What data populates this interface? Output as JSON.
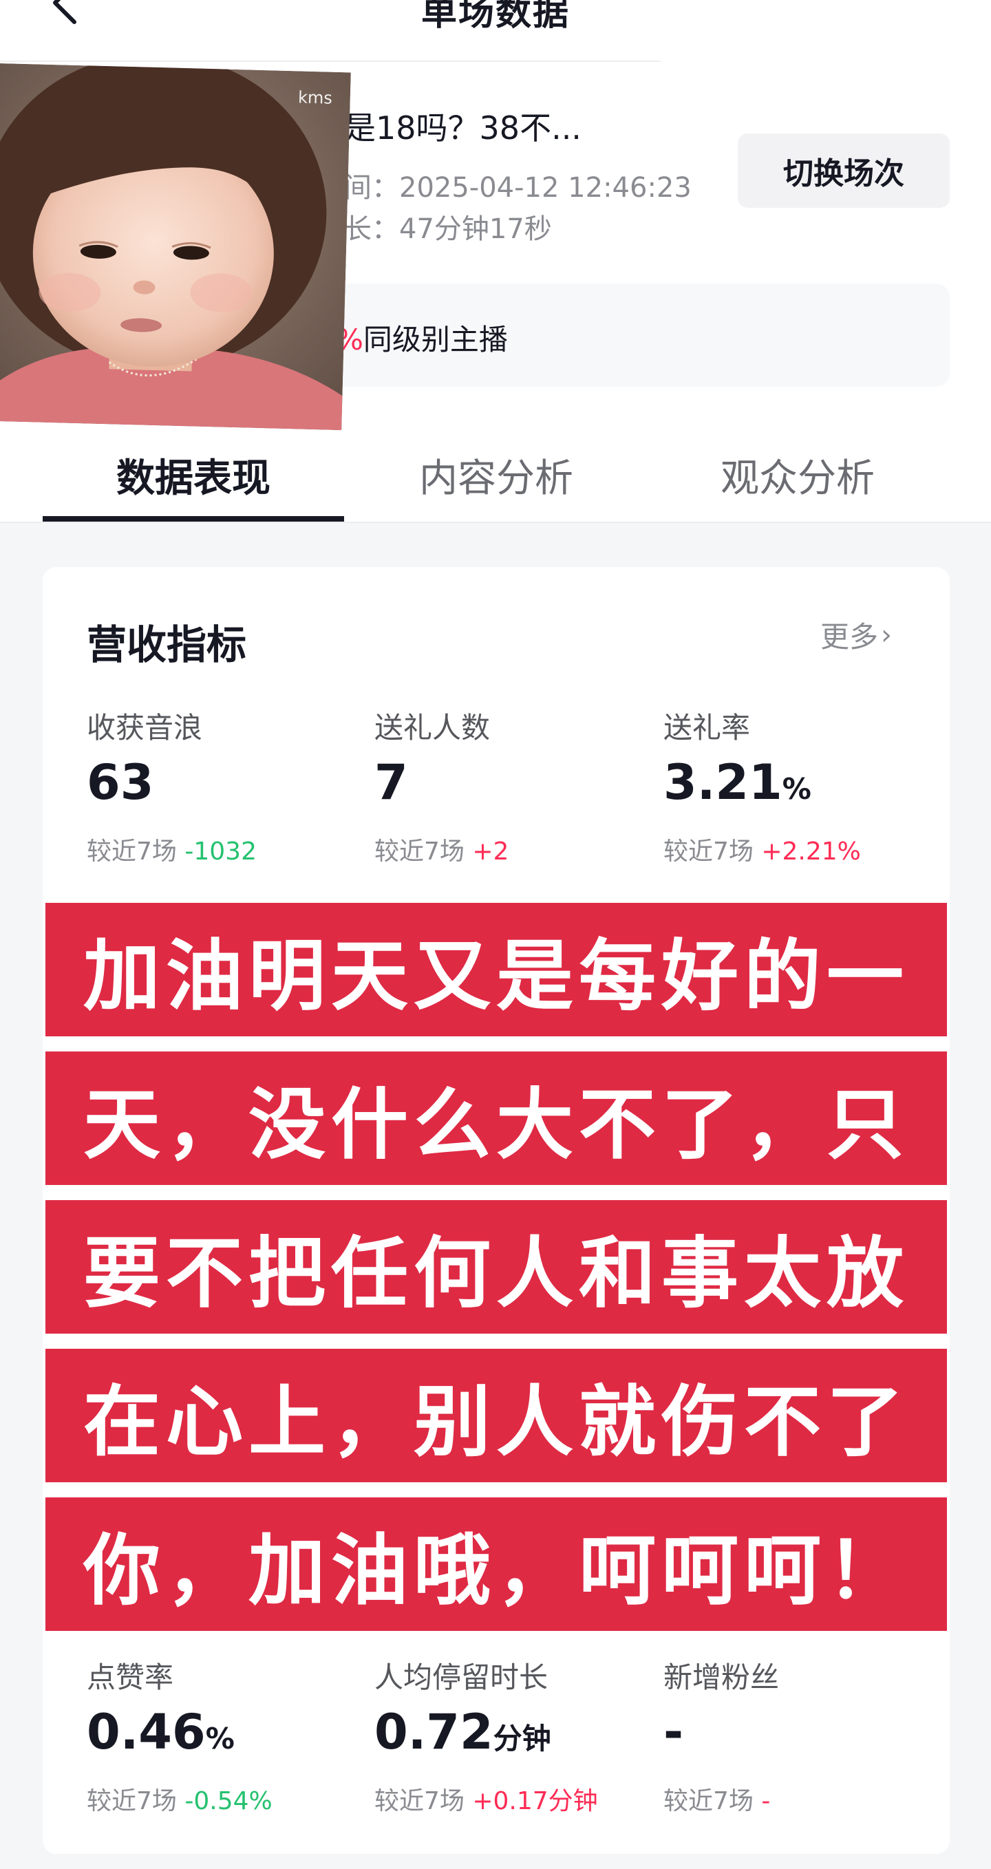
{
  "nav": {
    "title": "单场数据",
    "back_icon": "chevron-left-icon"
  },
  "sticker": {
    "watermark": "kms"
  },
  "session": {
    "title": "是18吗？38不...",
    "start_time": "间：2025-04-12 12:46:23",
    "duration": "长：47分钟17秒",
    "switch_label": "切换场次"
  },
  "compare": {
    "percent_fragment": "%",
    "text": "同级别主播"
  },
  "tabs": [
    {
      "label": "数据表现",
      "active": true
    },
    {
      "label": "内容分析",
      "active": false
    },
    {
      "label": "观众分析",
      "active": false
    }
  ],
  "revenue": {
    "title": "营收指标",
    "more_label": "更多",
    "metrics": [
      {
        "label": "收获音浪",
        "value": "63",
        "unit": "",
        "compare_prefix": "较近7场",
        "delta": "-1032",
        "delta_color": "#25c16f"
      },
      {
        "label": "送礼人数",
        "value": "7",
        "unit": "",
        "compare_prefix": "较近7场",
        "delta": "+2",
        "delta_color": "#fe2c55"
      },
      {
        "label": "送礼率",
        "value": "3.21",
        "unit": "%",
        "compare_prefix": "较近7场",
        "delta": "+2.21%",
        "delta_color": "#fe2c55"
      },
      {
        "label": "点赞率",
        "value": "0.46",
        "unit": "%",
        "compare_prefix": "较近7场",
        "delta": "-0.54%",
        "delta_color": "#25c16f"
      },
      {
        "label": "人均停留时长",
        "value": "0.72",
        "unit": "分钟",
        "compare_prefix": "较近7场",
        "delta": "+0.17分钟",
        "delta_color": "#fe2c55"
      },
      {
        "label": "新增粉丝",
        "value": "-",
        "unit": "",
        "compare_prefix": "较近7场",
        "delta": "-",
        "delta_color": "#fe2c55"
      }
    ]
  },
  "caption": {
    "color": "#df2a44",
    "lines": [
      "加油明天又是每好的一",
      "天，没什么大不了，只",
      "要不把任何人和事太放",
      "在心上，别人就伤不了",
      "你，加油哦，呵呵呵！"
    ]
  }
}
